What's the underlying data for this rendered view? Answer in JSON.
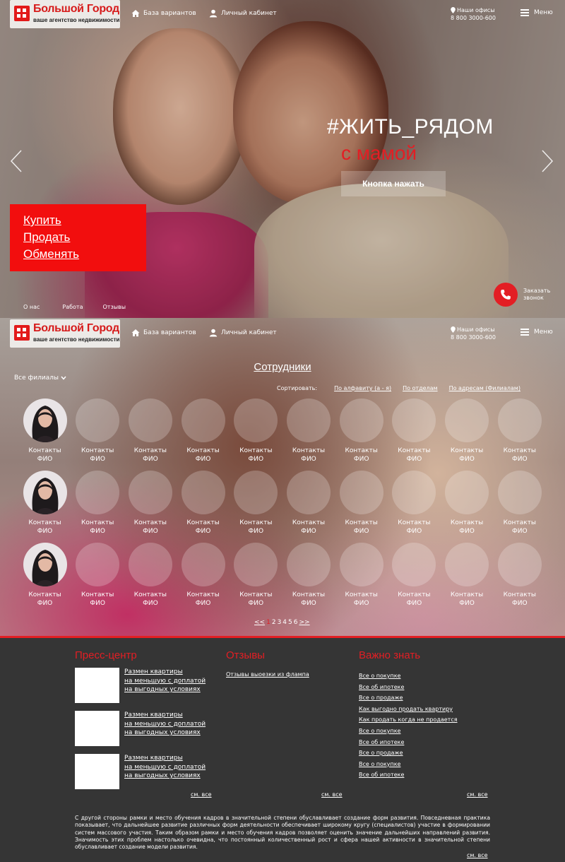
{
  "header": {
    "logo_brand": "Большой Город",
    "logo_tagline": "ваше агентство недвижимости",
    "nav_catalog": "База вариантов",
    "nav_account": "Личный кабинет",
    "offices_label": "Наши офисы",
    "phone": "8 800 3000-600",
    "menu_label": "Меню"
  },
  "hero": {
    "title": "#ЖИТЬ_РЯДОМ",
    "subtitle": "с мамой",
    "button": "Кнопка нажать",
    "deals": [
      "Купить",
      "Продать",
      "Обменять"
    ],
    "footer_links": [
      "О нас",
      "Работа",
      "Отзывы"
    ],
    "callback": [
      "Заказать",
      "звонок"
    ]
  },
  "staff": {
    "title": "Сотрудники",
    "branch_filter": "Все филиалы",
    "sort_label": "Сортировать:",
    "sort_options": [
      "По алфавиту (а - я)",
      "По отделам",
      "По адресам (Филиалам)"
    ],
    "card_line1": "Контакты",
    "card_line2": "ФИО",
    "pager": {
      "prev": "<<",
      "current": "1",
      "pages": [
        "2",
        "3",
        "4",
        "5",
        "6"
      ],
      "next": ">>"
    }
  },
  "footer": {
    "press_title": "Пресс-центр",
    "reviews_title": "Отзывы",
    "know_title": "Важно знать",
    "press_items": [
      [
        "Размен квартиры",
        "на меньшую с доплатой",
        "на выгодных условиях"
      ],
      [
        "Размен квартиры",
        "на меньшую с доплатой",
        "на выгодных условиях"
      ],
      [
        "Размен квартиры",
        "на меньшую с доплатой",
        "на выгодных условиях"
      ]
    ],
    "review_link": "Отзывы выоезки из флампа",
    "know_links": [
      "Все о покупке",
      "Все об ипотеке",
      "Все о продаже",
      "Как выгодно продать квартиру",
      "Как продать когда не продается",
      "Все о покупке",
      "Все об ипотеке",
      "Все о продаже",
      "Все о покупке",
      "Все об ипотеке"
    ],
    "see_all": "см. все",
    "about": "С другой стороны рамки и место обучения кадров в значительной степени обуславливает создание форм развития. Повседневная практика показывает, что дальнейшее развитие различных форм деятельности обеспечивает широкому кругу (специалистов) участие в формировании систем массового участия. Таким образом рамки и место обучения кадров позволяет оценить значение дальнейших направлений развития. Значимость этих проблем настолько очевидна, что постоянный количественный рост и сфера нашей активности в значительной степени обуславливает создание модели развития."
  },
  "colors": {
    "accent": "#e31e24",
    "footer_bg": "#353535"
  }
}
